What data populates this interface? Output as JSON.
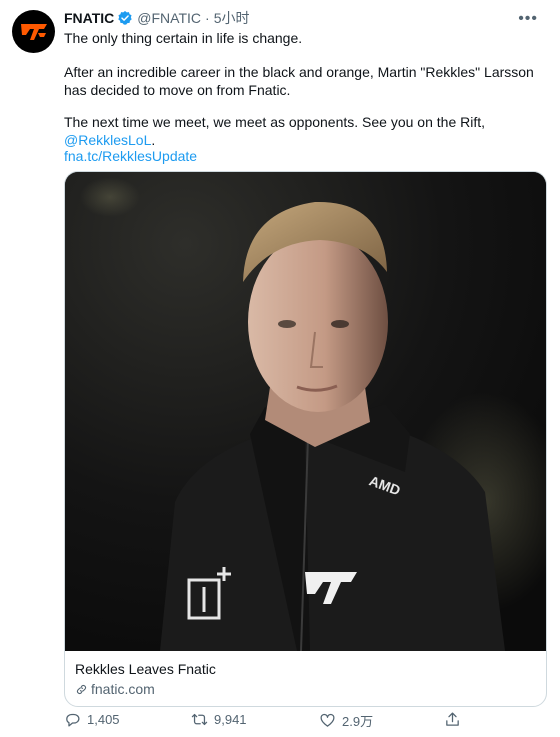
{
  "account": {
    "name": "FNATIC",
    "handle": "@FNATIC",
    "separator": "·",
    "time": "5小时"
  },
  "tweet": {
    "line1": "The only thing certain in life is change.",
    "line2": "After an incredible career in the black and orange, Martin \"Rekkles\" Larsson has decided to move on from Fnatic.",
    "line3_text": "The next time we meet, we meet as opponents. See you on the Rift, ",
    "line3_mention": "@RekklesLoL",
    "line3_end": ".",
    "link": "fna.tc/RekklesUpdate"
  },
  "card": {
    "title": "Rekkles Leaves Fnatic",
    "domain": "fnatic.com"
  },
  "actions": {
    "replies": "1,405",
    "retweets": "9,941",
    "likes": "2.9万"
  },
  "colors": {
    "brand_orange": "#ff5900",
    "link_blue": "#1d9bf0",
    "muted": "#536471"
  },
  "icons": {
    "avatar": "fnatic-logo",
    "verified": "verified-badge-icon",
    "more": "more-icon",
    "link": "link-icon",
    "reply": "reply-icon",
    "retweet": "retweet-icon",
    "like": "heart-icon",
    "share": "share-icon"
  }
}
